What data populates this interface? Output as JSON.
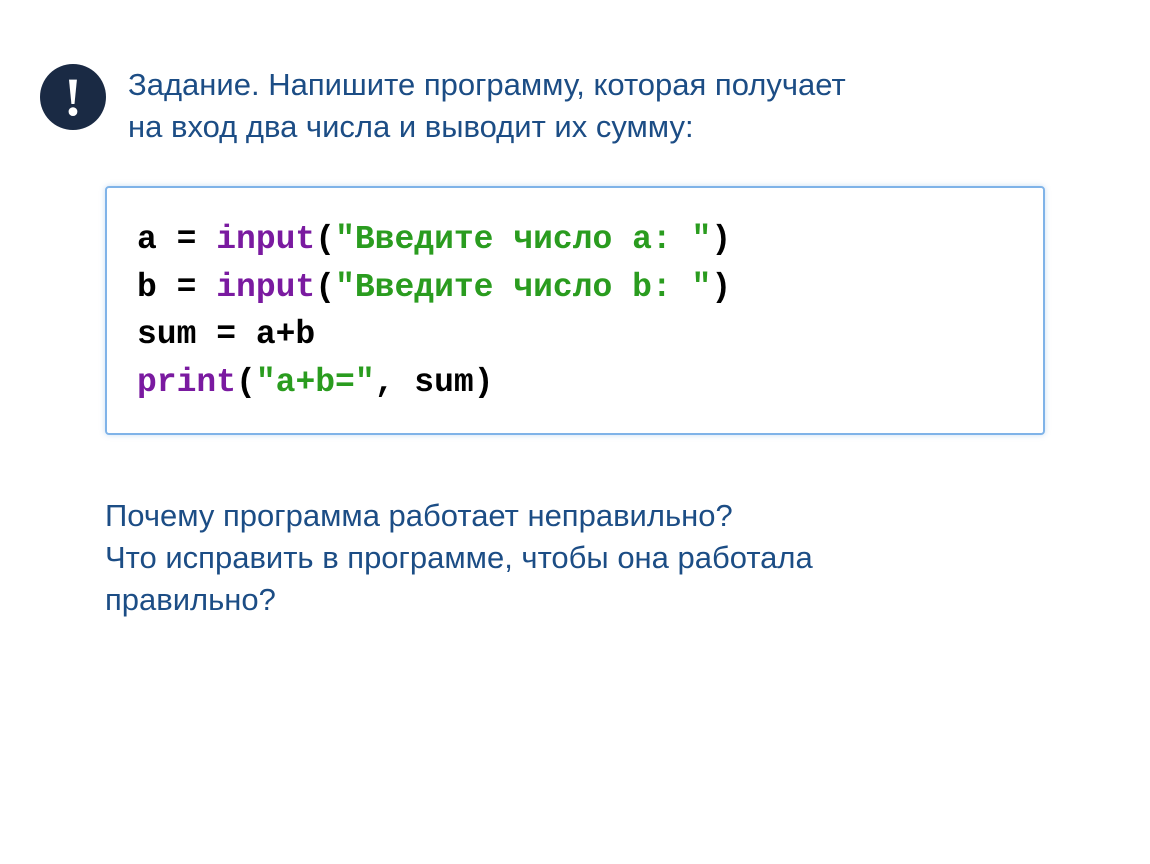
{
  "task": {
    "line1": "Задание. Напишите программу, которая получает",
    "line2": "на вход два числа и выводит их сумму:"
  },
  "exclaim": "!",
  "code": {
    "l1_a": "a = ",
    "l1_fn": "input",
    "l1_p1": "(",
    "l1_str": "\"Введите число a: \"",
    "l1_p2": ")",
    "l2_a": "b = ",
    "l2_fn": "input",
    "l2_p1": "(",
    "l2_str": "\"Введите число b: \"",
    "l2_p2": ")",
    "l3": "sum = a+b",
    "l4_fn": "print",
    "l4_p1": "(",
    "l4_str": "\"a+b=\"",
    "l4_rest": ", sum)"
  },
  "question": {
    "line1": "Почему программа работает неправильно?",
    "line2": "Что исправить в программе, чтобы она работала",
    "line3": "правильно?"
  }
}
